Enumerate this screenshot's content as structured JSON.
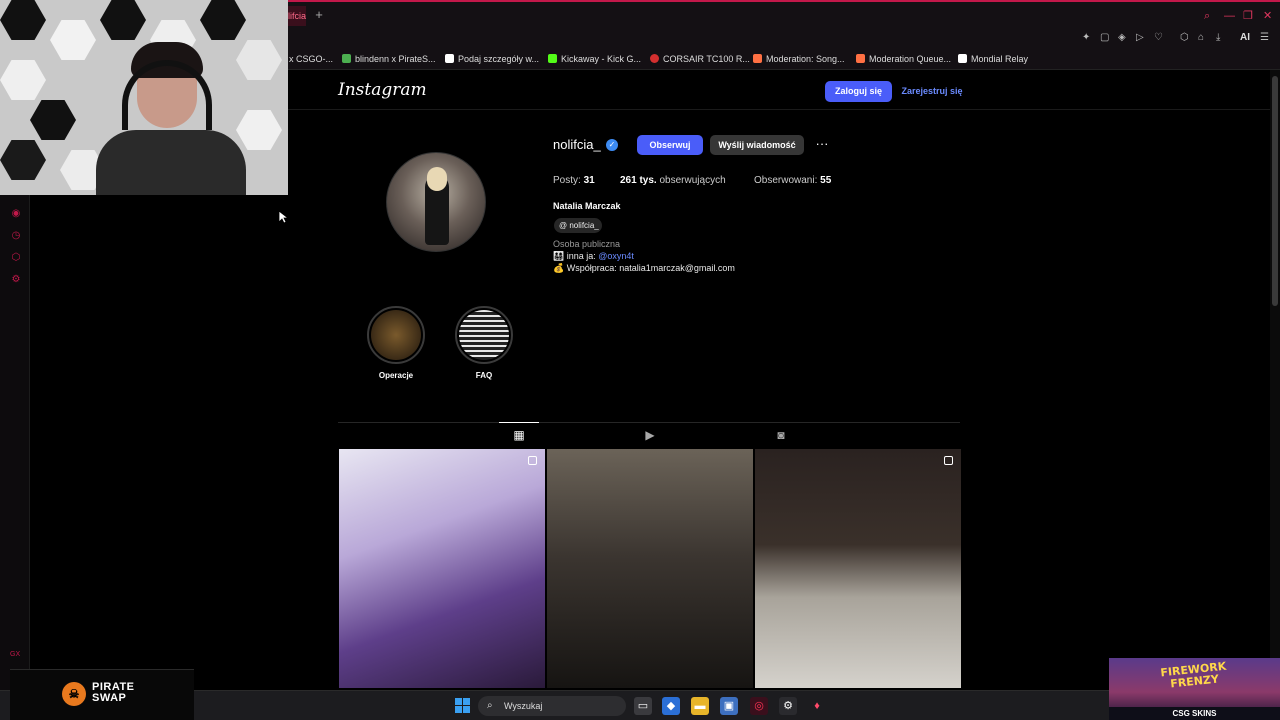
{
  "browser": {
    "active_tab_title": "lifcia",
    "new_tab_label": "+",
    "ai_label": "AI",
    "bookmarks": [
      {
        "label": "x CSGO-...",
        "color": "#555555"
      },
      {
        "label": "blindenn x PirateS...",
        "color": "#4caf50"
      },
      {
        "label": "Podaj szczegóły w...",
        "color": "#ffffff"
      },
      {
        "label": "Kickaway - Kick G...",
        "color": "#53fc18"
      },
      {
        "label": "CORSAIR TC100 R...",
        "color": "#d32f2f"
      },
      {
        "label": "Moderation: Song...",
        "color": "#ff7043"
      },
      {
        "label": "Moderation Queue...",
        "color": "#ff7043"
      },
      {
        "label": "Mondial Relay",
        "color": "#ffffff"
      }
    ]
  },
  "instagram": {
    "logo": "Instagram",
    "login_label": "Zaloguj się",
    "register_label": "Zarejestruj się",
    "profile": {
      "username": "nolifcia_",
      "follow_label": "Obserwuj",
      "message_label": "Wyślij wiadomość",
      "more_label": "···",
      "posts_label": "Posty:",
      "posts_value": "31",
      "followers_value": "261 tys.",
      "followers_label": "obserwujących",
      "following_label": "Obserwowani:",
      "following_value": "55",
      "full_name": "Natalia Marczak",
      "threads_handle": "nolifcia_",
      "category": "Osoba publiczna",
      "bio_line1_prefix": "👨‍👩‍👧‍👦 inna ja:",
      "bio_line1_link": "@oxyn4t",
      "bio_line2": "💰 Współpraca: natalia1marczak@gmail.com"
    },
    "highlights": [
      {
        "label": "Operacje"
      },
      {
        "label": "FAQ"
      }
    ]
  },
  "taskbar": {
    "search_placeholder": "Wyszukaj"
  },
  "sponsors": {
    "left_name_line1": "PIRATE",
    "left_name_line2": "SWAP",
    "right_title_line1": "FIREWORK",
    "right_title_line2": "FRENZY",
    "right_brand": "CSG SKINS"
  }
}
